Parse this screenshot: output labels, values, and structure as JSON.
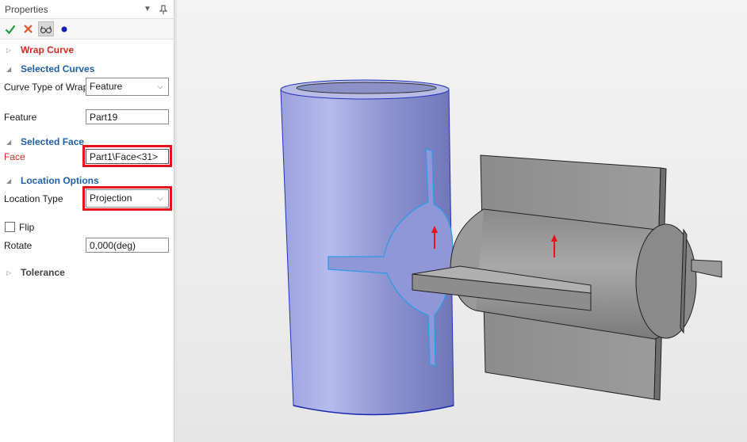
{
  "panel": {
    "title": "Properties",
    "title_icons": [
      "dropdown-arrow-icon",
      "pin-icon"
    ],
    "toolbar": {
      "ok_icon": "checkmark-icon",
      "cancel_icon": "cross-icon",
      "preview_icon": "glasses-icon",
      "dot_icon": "dot-icon"
    }
  },
  "sections": {
    "wrap_curve": "Wrap Curve",
    "selected_curves": "Selected Curves",
    "selected_face": "Selected Face",
    "location_options": "Location Options",
    "tolerance": "Tolerance"
  },
  "fields": {
    "curve_type_label": "Curve Type of Wrap",
    "curve_type_value": "Feature",
    "feature_label": "Feature",
    "feature_value": "Part19",
    "face_label": "Face",
    "face_value": "Part1\\Face<31>",
    "location_type_label": "Location Type",
    "location_type_value": "Projection",
    "flip_label": "Flip",
    "flip_checked": false,
    "rotate_label": "Rotate",
    "rotate_value": "0,000(deg)"
  },
  "colors": {
    "section_red": "#d42a1f",
    "section_blue": "#1f5fa8",
    "highlight": "#e8131a",
    "cylinder": "#8f97d6",
    "wrap_outline": "#2f9be6",
    "part_gray": "#8e8e8e"
  }
}
